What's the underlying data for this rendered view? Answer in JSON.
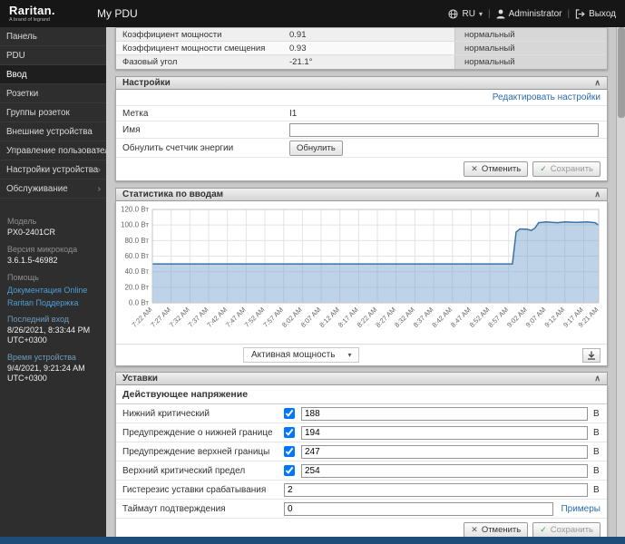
{
  "header": {
    "logo_title": "Raritan.",
    "logo_subtitle": "A brand of legrand",
    "app_title": "My PDU",
    "lang": "RU",
    "user": "Administrator",
    "logout": "Выход"
  },
  "sidebar": {
    "items": [
      {
        "label": "Панель"
      },
      {
        "label": "PDU"
      },
      {
        "label": "Ввод"
      },
      {
        "label": "Розетки"
      },
      {
        "label": "Группы розеток"
      },
      {
        "label": "Внешние устройства"
      },
      {
        "label": "Управление пользователями"
      },
      {
        "label": "Настройки устройства"
      },
      {
        "label": "Обслуживание"
      }
    ],
    "info": {
      "model_label": "Модель",
      "model": "PX0-2401CR",
      "firmware_label": "Версия микрокода",
      "firmware": "3.6.1.5-46982",
      "help_label": "Помощь",
      "link_docs": "Документация Online",
      "link_support": "Raritan Поддержка",
      "last_login_label": "Последний вход",
      "last_login": "8/26/2021, 8:33:44 PM UTC+0300",
      "device_time_label": "Время устройства",
      "device_time": "9/4/2021, 9:21:24 AM UTC+0300"
    }
  },
  "sensor_table": {
    "rows": [
      {
        "name": "Коэффициент мощности",
        "value": "0.91",
        "status": "нормальный"
      },
      {
        "name": "Коэффициент мощности смещения",
        "value": "0.93",
        "status": "нормальный"
      },
      {
        "name": "Фазовый угол",
        "value": "-21.1°",
        "status": "нормальный"
      }
    ]
  },
  "settings": {
    "title": "Настройки",
    "edit_link": "Редактировать настройки",
    "label_row_label": "Метка",
    "label_row_value": "I1",
    "name_row_label": "Имя",
    "name_row_value": "",
    "reset_row_label": "Обнулить счетчик энергии",
    "reset_button": "Обнулить",
    "cancel": "Отменить",
    "save": "Сохранить"
  },
  "statistics": {
    "title": "Статистика по вводам",
    "metric_select": "Активная мощность",
    "chart_data": {
      "type": "area",
      "title": "Статистика по вводам",
      "unit": "Вт",
      "ylim": [
        0,
        120
      ],
      "yticks": [
        0,
        20,
        40,
        60,
        80,
        100,
        120
      ],
      "x_range": [
        0,
        119
      ],
      "grid": true,
      "x_ticks": [
        {
          "m": 0,
          "label": "7:22 AM"
        },
        {
          "m": 5,
          "label": "7:27 AM"
        },
        {
          "m": 10,
          "label": "7:32 AM"
        },
        {
          "m": 15,
          "label": "7:37 AM"
        },
        {
          "m": 20,
          "label": "7:42 AM"
        },
        {
          "m": 25,
          "label": "7:47 AM"
        },
        {
          "m": 30,
          "label": "7:52 AM"
        },
        {
          "m": 35,
          "label": "7:57 AM"
        },
        {
          "m": 40,
          "label": "8:02 AM"
        },
        {
          "m": 45,
          "label": "8:07 AM"
        },
        {
          "m": 50,
          "label": "8:12 AM"
        },
        {
          "m": 55,
          "label": "8:17 AM"
        },
        {
          "m": 60,
          "label": "8:22 AM"
        },
        {
          "m": 65,
          "label": "8:27 AM"
        },
        {
          "m": 70,
          "label": "8:32 AM"
        },
        {
          "m": 75,
          "label": "8:37 AM"
        },
        {
          "m": 80,
          "label": "8:42 AM"
        },
        {
          "m": 85,
          "label": "8:47 AM"
        },
        {
          "m": 90,
          "label": "8:52 AM"
        },
        {
          "m": 95,
          "label": "8:57 AM"
        },
        {
          "m": 100,
          "label": "9:02 AM"
        },
        {
          "m": 105,
          "label": "9:07 AM"
        },
        {
          "m": 110,
          "label": "9:12 AM"
        },
        {
          "m": 115,
          "label": "9:17 AM"
        },
        {
          "m": 119,
          "label": "9:21 AM"
        }
      ],
      "series": [
        {
          "name": "Активная мощность",
          "points": [
            [
              0,
              50
            ],
            [
              95,
              50
            ],
            [
              96,
              50
            ],
            [
              97,
              91
            ],
            [
              98,
              95
            ],
            [
              100,
              94.5
            ],
            [
              101,
              93
            ],
            [
              102,
              96
            ],
            [
              103,
              103
            ],
            [
              105,
              104
            ],
            [
              108,
              103
            ],
            [
              110,
              104
            ],
            [
              113,
              103.5
            ],
            [
              116,
              104
            ],
            [
              118,
              103
            ],
            [
              119,
              100
            ]
          ]
        }
      ]
    }
  },
  "thresholds": {
    "title": "Уставки",
    "subtitle": "Действующее напряжение",
    "rows": [
      {
        "label": "Нижний критический",
        "value": "188",
        "unit": "В"
      },
      {
        "label": "Предупреждение о нижней границе",
        "value": "194",
        "unit": "В"
      },
      {
        "label": "Предупреждение верхней границы",
        "value": "247",
        "unit": "В"
      },
      {
        "label": "Верхний критический предел",
        "value": "254",
        "unit": "В"
      },
      {
        "label": "Гистерезис уставки срабатывания",
        "value": "2",
        "unit": "В"
      },
      {
        "label": "Таймаут подтверждения",
        "value": "0",
        "link": "Примеры"
      }
    ],
    "cancel": "Отменить",
    "save": "Сохранить"
  }
}
